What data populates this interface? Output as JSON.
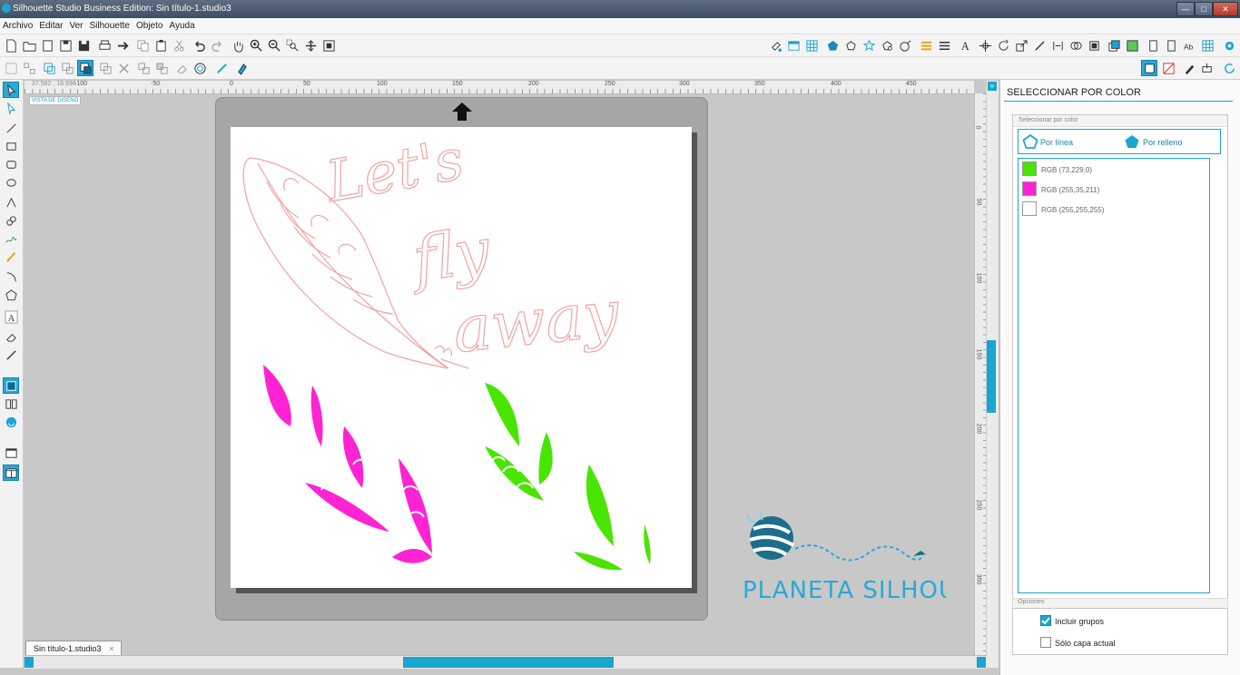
{
  "window": {
    "title": "Silhouette Studio Business Edition: Sin título-1.studio3",
    "min": "—",
    "max": "□",
    "close": "✕"
  },
  "menu": [
    "Archivo",
    "Editar",
    "Ver",
    "Silhouette",
    "Objeto",
    "Ayuda"
  ],
  "canvas": {
    "view_label": "VISTA DE DISEÑO",
    "coords": "37.582 , 18.936",
    "text_line1": "Let's",
    "text_line2": "fly",
    "text_line3": "away",
    "ruler_top": [
      "-100",
      "-50",
      "0",
      "50",
      "100",
      "150",
      "200",
      "250",
      "300",
      "350",
      "400",
      "450"
    ],
    "ruler_right": [
      "0",
      "50",
      "100",
      "150",
      "200",
      "250",
      "300"
    ]
  },
  "watermark": {
    "text": "PLANETA SILHOUETTE"
  },
  "doc_tab": {
    "label": "Sin título-1.studio3",
    "close": "×"
  },
  "panel": {
    "title": "SELECCIONAR POR COLOR",
    "section": "Seleccionar por color",
    "by_line": "Por línea",
    "by_fill": "Por relleno",
    "colors": [
      {
        "label": "RGB (73,229,0)",
        "hex": "#49e500"
      },
      {
        "label": "RGB (255,35,211)",
        "hex": "#ff23d3"
      },
      {
        "label": "RGB (255,255,255)",
        "hex": "#ffffff"
      }
    ],
    "options_title": "Opciones",
    "include_groups": "Incluir grupos",
    "include_groups_checked": true,
    "current_layer": "Sólo capa actual",
    "current_layer_checked": false
  },
  "colors": {
    "accent": "#1aa6d0",
    "green": "#49e500",
    "magenta": "#ff23d3",
    "outline": "#f2a3a3"
  }
}
